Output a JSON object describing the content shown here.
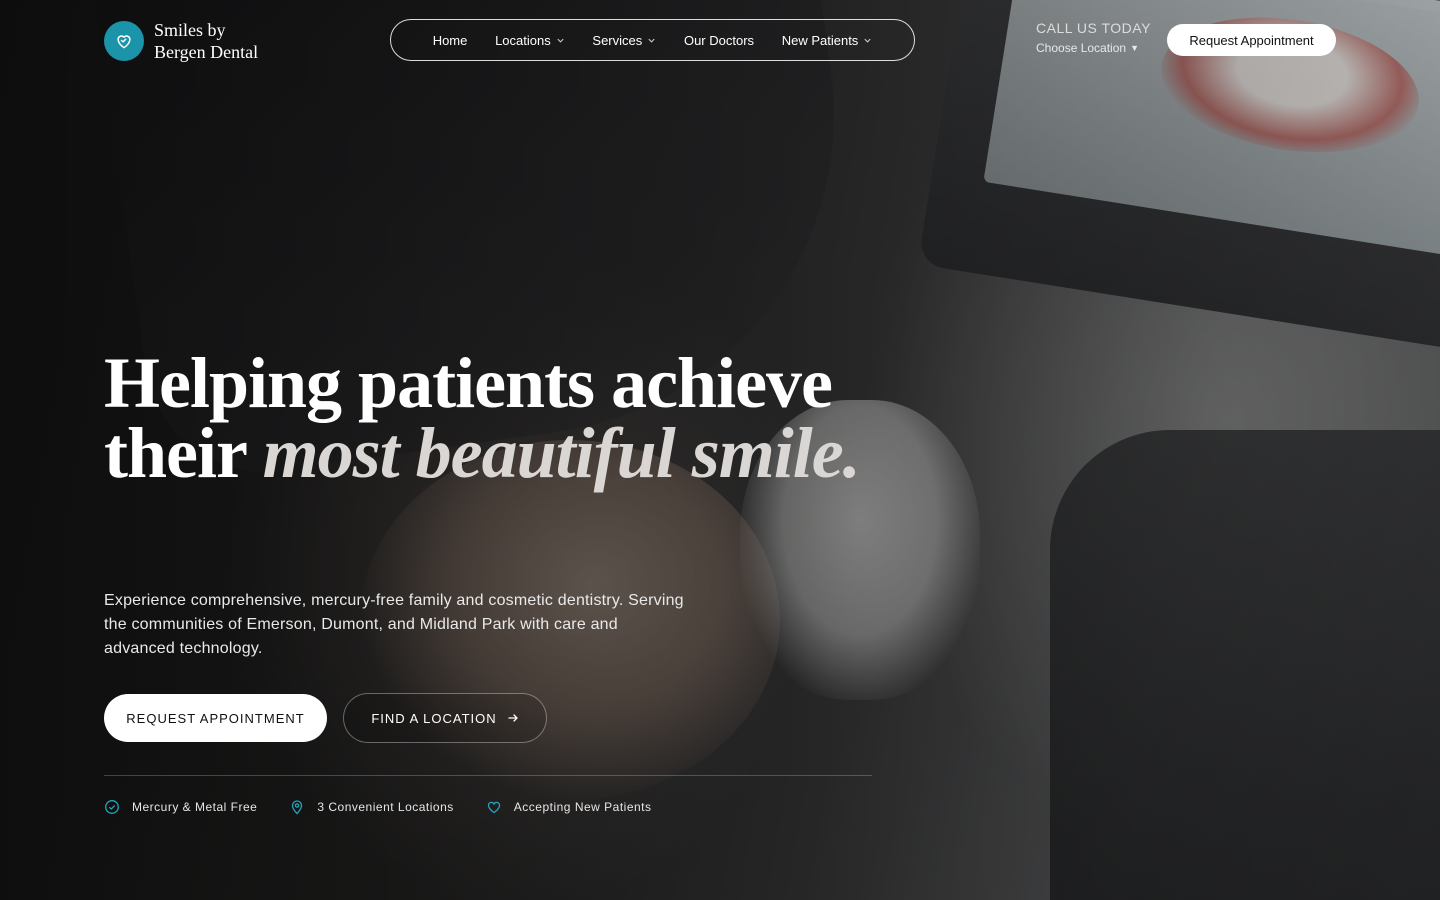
{
  "brand": {
    "name_line1": "Smiles by",
    "name_line2": "Bergen Dental",
    "logo_icon": "heart-icon",
    "accent_color": "#1b93a8"
  },
  "nav": {
    "items": [
      {
        "label": "Home",
        "dropdown": false
      },
      {
        "label": "Locations",
        "dropdown": true
      },
      {
        "label": "Services",
        "dropdown": true
      },
      {
        "label": "Our Doctors",
        "dropdown": false
      },
      {
        "label": "New Patients",
        "dropdown": true
      }
    ]
  },
  "header": {
    "call_title": "CALL US TODAY",
    "choose_location": "Choose Location",
    "choose_location_icon": "caret-down-icon",
    "cta_label": "Request Appointment"
  },
  "hero": {
    "headline_part1": "Helping patients achieve their",
    "headline_italic": "most beautiful smile.",
    "subtext": "Experience comprehensive, mercury-free family and cosmetic dentistry. Serving the communities of Emerson, Dumont, and Midland Park with care and advanced technology.",
    "primary_button": "REQUEST APPOINTMENT",
    "secondary_button": "FIND A LOCATION",
    "secondary_button_icon": "arrow-right-icon"
  },
  "features": [
    {
      "label": "Mercury & Metal Free",
      "icon": "check-circle-icon"
    },
    {
      "label": "3 Convenient Locations",
      "icon": "map-pin-icon"
    },
    {
      "label": "Accepting New Patients",
      "icon": "heart-icon"
    }
  ]
}
